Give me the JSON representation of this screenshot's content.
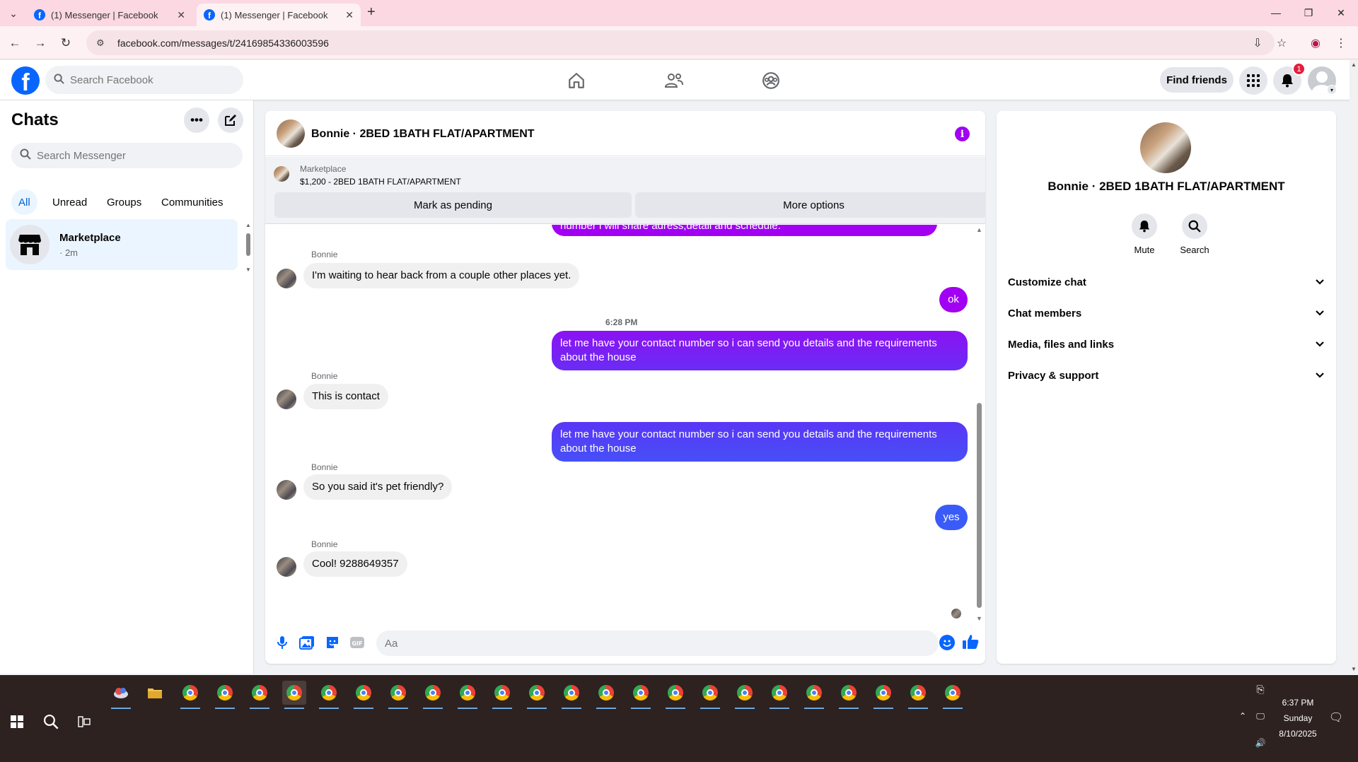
{
  "browser": {
    "tabs": [
      {
        "title": "(1) Messenger | Facebook",
        "active": false
      },
      {
        "title": "(1) Messenger | Facebook",
        "active": true
      }
    ],
    "url": "facebook.com/messages/t/24169854336003596"
  },
  "fb_header": {
    "search_placeholder": "Search Facebook",
    "find_friends": "Find friends",
    "notification_count": "1"
  },
  "chats": {
    "title": "Chats",
    "search_placeholder": "Search Messenger",
    "filters": [
      "All",
      "Unread",
      "Groups",
      "Communities"
    ],
    "items": [
      {
        "name": "Marketplace",
        "meta": "· 2m"
      }
    ]
  },
  "conversation": {
    "title": "Bonnie · 2BED 1BATH FLAT/APARTMENT",
    "marketplace": {
      "label": "Marketplace",
      "listing": "$1,200 - 2BED 1BATH FLAT/APARTMENT",
      "mark_pending": "Mark as pending",
      "more_options": "More options"
    },
    "messages": {
      "cut_off": "number i will share adress,detail and schedule.",
      "m1_sender": "Bonnie",
      "m1_text": "I'm waiting to hear back from a couple other places yet.",
      "m2_text": "ok",
      "timestamp": "6:28 PM",
      "m3_text": "let me have your contact number so i can send you details and the requirements about the house",
      "m4_sender": "Bonnie",
      "m4_text": "This is contact",
      "m5_text": "let me have your contact number so i can send you details and the requirements about the house",
      "m6_sender": "Bonnie",
      "m6_text": "So you said it's pet friendly?",
      "m7_text": "yes",
      "m8_sender": "Bonnie",
      "m8_text": "Cool! 9288649357"
    },
    "composer_placeholder": "Aa"
  },
  "details": {
    "title": "Bonnie · 2BED 1BATH FLAT/APARTMENT",
    "actions": [
      "Mute",
      "Search"
    ],
    "sections": [
      "Customize chat",
      "Chat members",
      "Media, files and links",
      "Privacy & support"
    ]
  },
  "taskbar": {
    "time": "6:37 PM",
    "day": "Sunday",
    "date": "8/10/2025"
  },
  "colors": {
    "fb_blue": "#0866ff",
    "accent_purple": "#a100f2",
    "bubble_gradient_top": "#a100f2",
    "bubble_gradient_mid": "#6f2bf5",
    "bubble_gradient_bottom": "#3b5bf8",
    "chrome_pink": "#fbd8e2"
  }
}
